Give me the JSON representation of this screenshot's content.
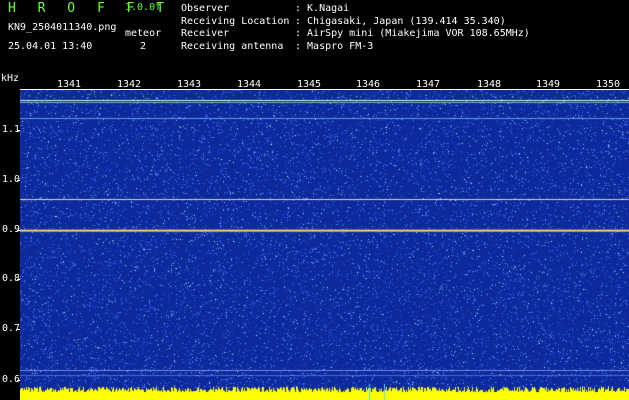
{
  "header": {
    "logo": "H R O F F T",
    "version": "1.0.0f",
    "filename": "KN9_2504011340.png",
    "meteor_label": "meteor",
    "meteor_count": "2",
    "datetime": "25.04.01 13:40",
    "meta": [
      {
        "label": "Observer",
        "value": ": K.Nagai"
      },
      {
        "label": "Receiving Location",
        "value": ": Chigasaki, Japan (139.414 35.340)"
      },
      {
        "label": "Receiver",
        "value": ": AirSpy mini (Miakejima VOR 108.65MHz)"
      },
      {
        "label": "Receiving antenna",
        "value": ": Maspro FM-3"
      }
    ]
  },
  "axes": {
    "y_unit": "kHz",
    "x_ticks": [
      "1341",
      "1342",
      "1343",
      "1344",
      "1345",
      "1346",
      "1347",
      "1348",
      "1349",
      "1350"
    ],
    "y_ticks": [
      "1.1",
      "1.0",
      "0.9",
      "0.8",
      "0.7",
      "0.6"
    ]
  },
  "colors": {
    "background": "#0d2a9c",
    "noise": "#3a6cff",
    "signal_line": "#ffff66",
    "baseline": "#ffff00",
    "logo": "#66ff33"
  }
}
